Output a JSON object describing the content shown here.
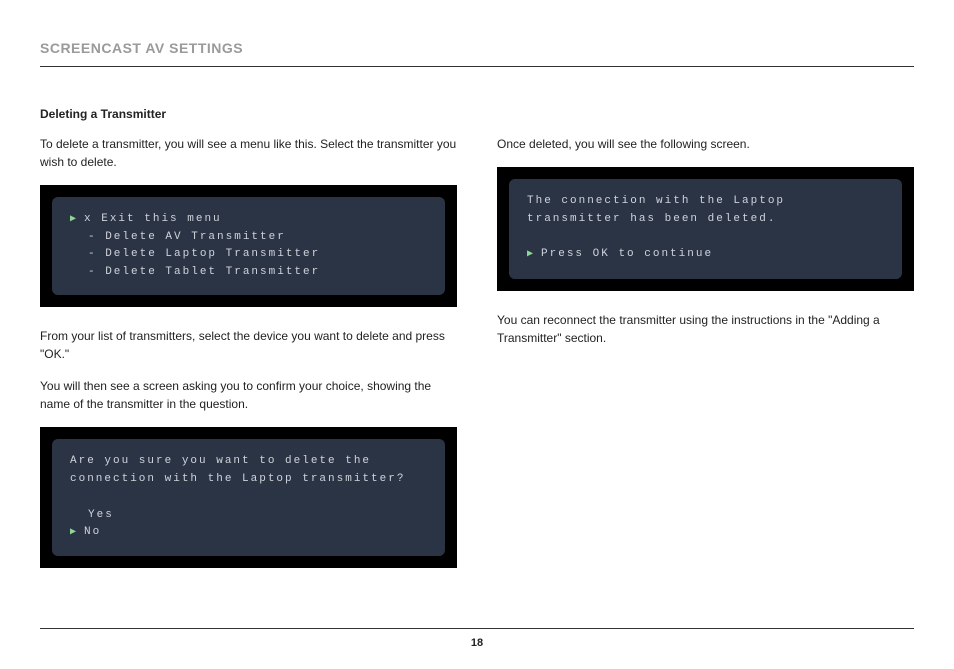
{
  "header": {
    "title": "SCREENCAST AV SETTINGS"
  },
  "section": {
    "heading": "Deleting a Transmitter"
  },
  "left": {
    "p1": "To delete a transmitter, you will see a menu like this. Select the transmitter you wish to delete.",
    "p2": "From your list of transmitters, select the device you want to delete and press \"OK.\"",
    "p3": "You will then see a screen asking you to confirm your choice, showing the name of the transmitter in the question."
  },
  "right": {
    "p1": "Once deleted, you will see the following screen.",
    "p2": "You can reconnect the transmitter using the instructions in the \"Adding a Transmitter\" section."
  },
  "osd1": {
    "line1": "x Exit this menu",
    "line2": "- Delete AV Transmitter",
    "line3": "- Delete Laptop Transmitter",
    "line4": "- Delete Tablet Transmitter"
  },
  "osd2": {
    "line1": "Are you sure you want to delete the",
    "line2": "connection with the Laptop transmitter?",
    "opt1": "Yes",
    "opt2": "No"
  },
  "osd3": {
    "line1": "The connection with the Laptop",
    "line2": "transmitter has been deleted.",
    "prompt": "Press OK to continue"
  },
  "footer": {
    "page": "18"
  }
}
